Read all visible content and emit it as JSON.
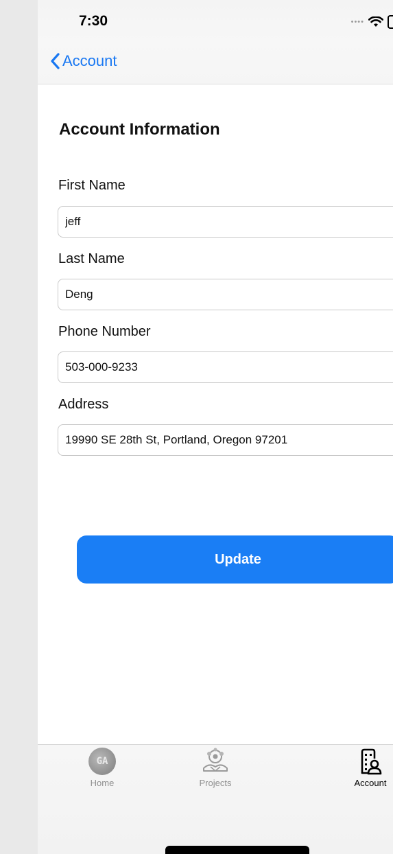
{
  "status_bar": {
    "time": "7:30"
  },
  "nav": {
    "back_label": "Account"
  },
  "page": {
    "title": "Account Information"
  },
  "form": {
    "first_name": {
      "label": "First Name",
      "value": "jeff"
    },
    "last_name": {
      "label": "Last Name",
      "value": "Deng"
    },
    "phone": {
      "label": "Phone Number",
      "value": "503-000-9233"
    },
    "address": {
      "label": "Address",
      "value": "19990 SE 28th St, Portland, Oregon 97201"
    }
  },
  "actions": {
    "update_label": "Update"
  },
  "tabbar": {
    "home": {
      "label": "Home",
      "logo_text": "GA",
      "icon": "ga-logo-icon"
    },
    "projects": {
      "label": "Projects",
      "icon": "projects-icon"
    },
    "account": {
      "label": "Account",
      "icon": "account-building-icon",
      "active": true
    }
  },
  "colors": {
    "accent": "#1a7ef5",
    "back_link": "#1877f2",
    "tab_inactive": "#8e8e8e"
  }
}
